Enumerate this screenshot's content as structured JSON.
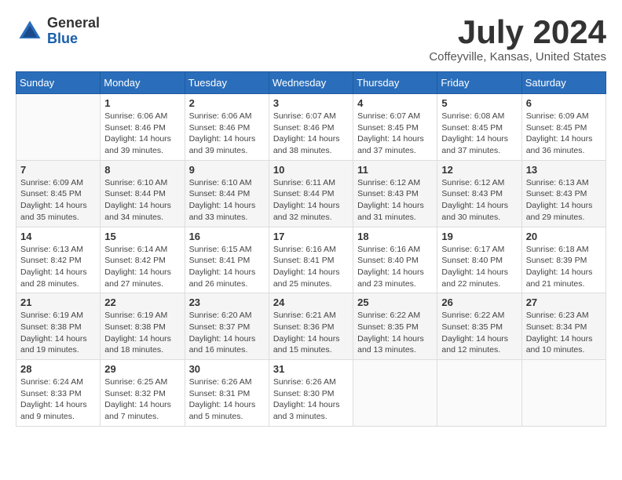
{
  "header": {
    "logo_line1": "General",
    "logo_line2": "Blue",
    "month_title": "July 2024",
    "location": "Coffeyville, Kansas, United States"
  },
  "weekdays": [
    "Sunday",
    "Monday",
    "Tuesday",
    "Wednesday",
    "Thursday",
    "Friday",
    "Saturday"
  ],
  "weeks": [
    [
      {
        "day": "",
        "info": ""
      },
      {
        "day": "1",
        "info": "Sunrise: 6:06 AM\nSunset: 8:46 PM\nDaylight: 14 hours\nand 39 minutes."
      },
      {
        "day": "2",
        "info": "Sunrise: 6:06 AM\nSunset: 8:46 PM\nDaylight: 14 hours\nand 39 minutes."
      },
      {
        "day": "3",
        "info": "Sunrise: 6:07 AM\nSunset: 8:46 PM\nDaylight: 14 hours\nand 38 minutes."
      },
      {
        "day": "4",
        "info": "Sunrise: 6:07 AM\nSunset: 8:45 PM\nDaylight: 14 hours\nand 37 minutes."
      },
      {
        "day": "5",
        "info": "Sunrise: 6:08 AM\nSunset: 8:45 PM\nDaylight: 14 hours\nand 37 minutes."
      },
      {
        "day": "6",
        "info": "Sunrise: 6:09 AM\nSunset: 8:45 PM\nDaylight: 14 hours\nand 36 minutes."
      }
    ],
    [
      {
        "day": "7",
        "info": "Sunrise: 6:09 AM\nSunset: 8:45 PM\nDaylight: 14 hours\nand 35 minutes."
      },
      {
        "day": "8",
        "info": "Sunrise: 6:10 AM\nSunset: 8:44 PM\nDaylight: 14 hours\nand 34 minutes."
      },
      {
        "day": "9",
        "info": "Sunrise: 6:10 AM\nSunset: 8:44 PM\nDaylight: 14 hours\nand 33 minutes."
      },
      {
        "day": "10",
        "info": "Sunrise: 6:11 AM\nSunset: 8:44 PM\nDaylight: 14 hours\nand 32 minutes."
      },
      {
        "day": "11",
        "info": "Sunrise: 6:12 AM\nSunset: 8:43 PM\nDaylight: 14 hours\nand 31 minutes."
      },
      {
        "day": "12",
        "info": "Sunrise: 6:12 AM\nSunset: 8:43 PM\nDaylight: 14 hours\nand 30 minutes."
      },
      {
        "day": "13",
        "info": "Sunrise: 6:13 AM\nSunset: 8:43 PM\nDaylight: 14 hours\nand 29 minutes."
      }
    ],
    [
      {
        "day": "14",
        "info": "Sunrise: 6:13 AM\nSunset: 8:42 PM\nDaylight: 14 hours\nand 28 minutes."
      },
      {
        "day": "15",
        "info": "Sunrise: 6:14 AM\nSunset: 8:42 PM\nDaylight: 14 hours\nand 27 minutes."
      },
      {
        "day": "16",
        "info": "Sunrise: 6:15 AM\nSunset: 8:41 PM\nDaylight: 14 hours\nand 26 minutes."
      },
      {
        "day": "17",
        "info": "Sunrise: 6:16 AM\nSunset: 8:41 PM\nDaylight: 14 hours\nand 25 minutes."
      },
      {
        "day": "18",
        "info": "Sunrise: 6:16 AM\nSunset: 8:40 PM\nDaylight: 14 hours\nand 23 minutes."
      },
      {
        "day": "19",
        "info": "Sunrise: 6:17 AM\nSunset: 8:40 PM\nDaylight: 14 hours\nand 22 minutes."
      },
      {
        "day": "20",
        "info": "Sunrise: 6:18 AM\nSunset: 8:39 PM\nDaylight: 14 hours\nand 21 minutes."
      }
    ],
    [
      {
        "day": "21",
        "info": "Sunrise: 6:19 AM\nSunset: 8:38 PM\nDaylight: 14 hours\nand 19 minutes."
      },
      {
        "day": "22",
        "info": "Sunrise: 6:19 AM\nSunset: 8:38 PM\nDaylight: 14 hours\nand 18 minutes."
      },
      {
        "day": "23",
        "info": "Sunrise: 6:20 AM\nSunset: 8:37 PM\nDaylight: 14 hours\nand 16 minutes."
      },
      {
        "day": "24",
        "info": "Sunrise: 6:21 AM\nSunset: 8:36 PM\nDaylight: 14 hours\nand 15 minutes."
      },
      {
        "day": "25",
        "info": "Sunrise: 6:22 AM\nSunset: 8:35 PM\nDaylight: 14 hours\nand 13 minutes."
      },
      {
        "day": "26",
        "info": "Sunrise: 6:22 AM\nSunset: 8:35 PM\nDaylight: 14 hours\nand 12 minutes."
      },
      {
        "day": "27",
        "info": "Sunrise: 6:23 AM\nSunset: 8:34 PM\nDaylight: 14 hours\nand 10 minutes."
      }
    ],
    [
      {
        "day": "28",
        "info": "Sunrise: 6:24 AM\nSunset: 8:33 PM\nDaylight: 14 hours\nand 9 minutes."
      },
      {
        "day": "29",
        "info": "Sunrise: 6:25 AM\nSunset: 8:32 PM\nDaylight: 14 hours\nand 7 minutes."
      },
      {
        "day": "30",
        "info": "Sunrise: 6:26 AM\nSunset: 8:31 PM\nDaylight: 14 hours\nand 5 minutes."
      },
      {
        "day": "31",
        "info": "Sunrise: 6:26 AM\nSunset: 8:30 PM\nDaylight: 14 hours\nand 3 minutes."
      },
      {
        "day": "",
        "info": ""
      },
      {
        "day": "",
        "info": ""
      },
      {
        "day": "",
        "info": ""
      }
    ]
  ]
}
